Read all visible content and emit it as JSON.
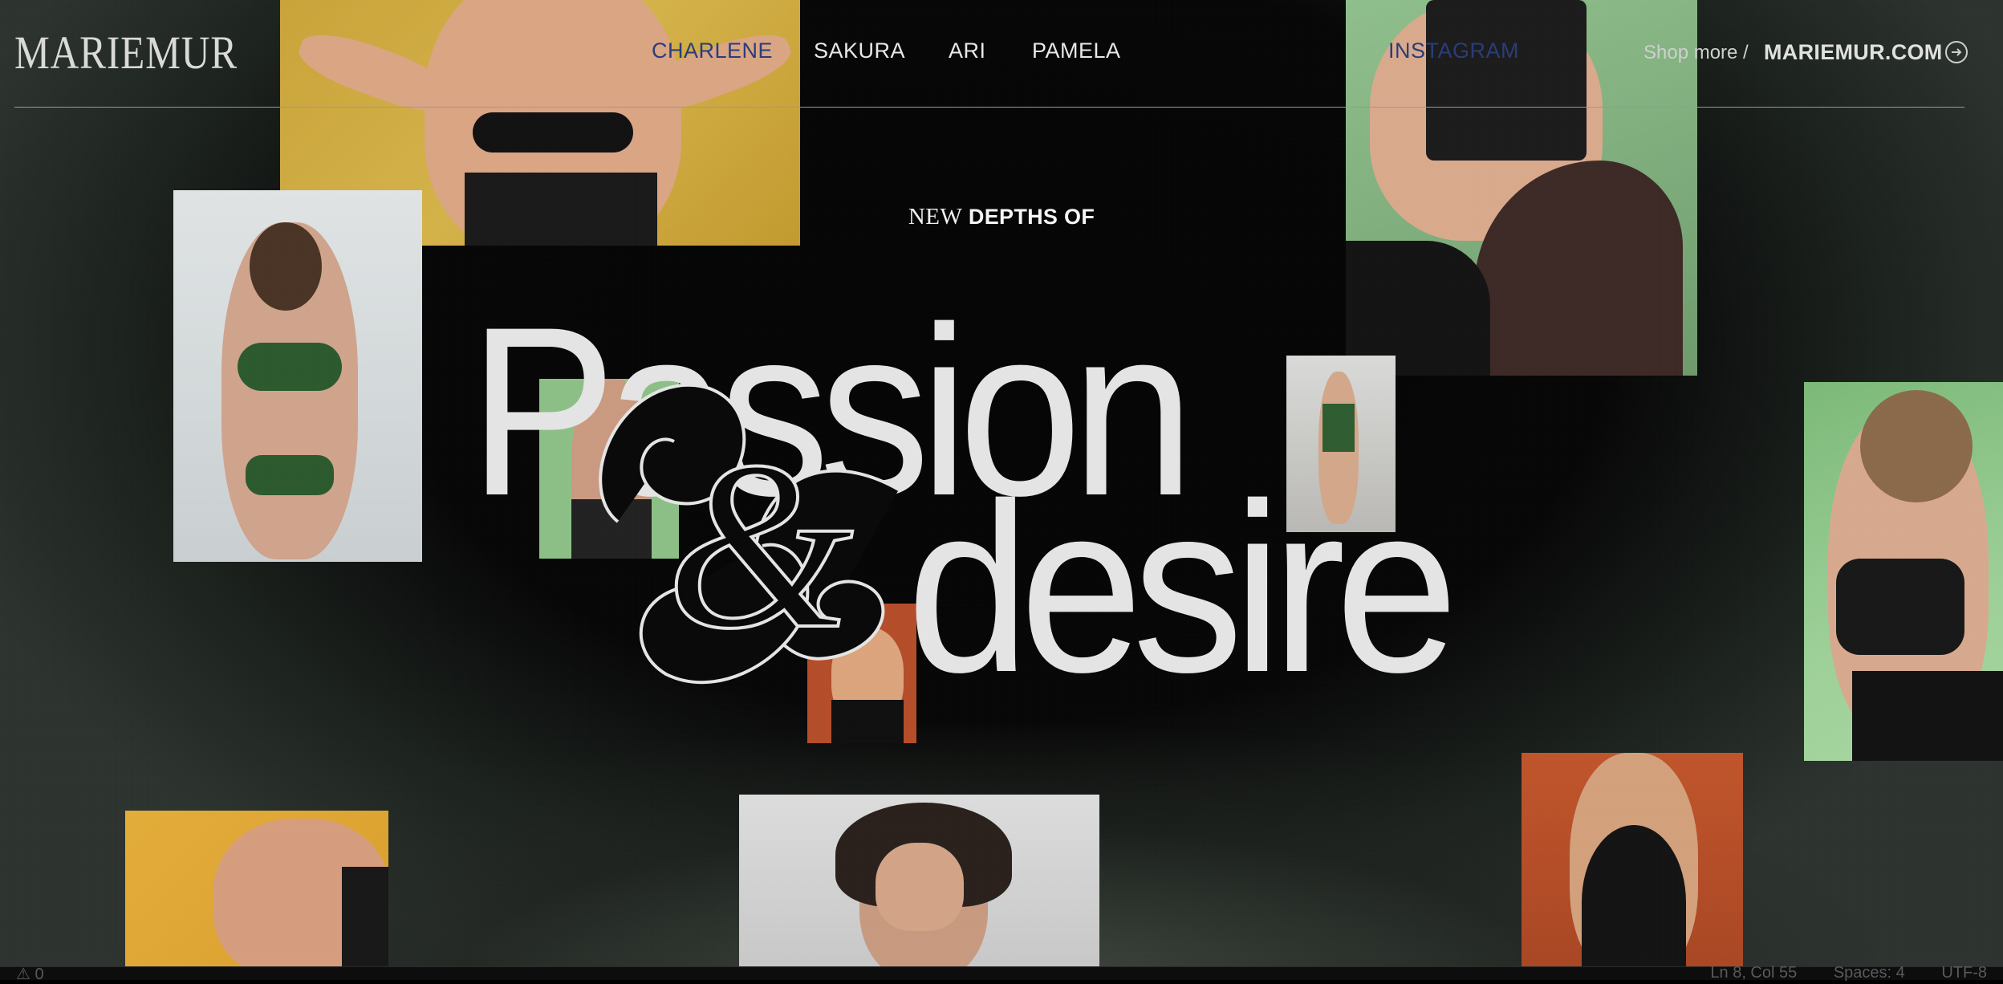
{
  "header": {
    "logo": "MARIEMUR",
    "nav": [
      {
        "label": "CHARLENE",
        "active": true
      },
      {
        "label": "SAKURA",
        "active": false
      },
      {
        "label": "ARI",
        "active": false
      },
      {
        "label": "PAMELA",
        "active": false
      }
    ],
    "instagram": "INSTAGRAM",
    "shop_more": "Shop more",
    "separator": "/",
    "domain": "MARIEMUR.COM",
    "arrow_icon": "arrow-right-circle-icon"
  },
  "hero": {
    "eyebrow_serif": "NEW",
    "eyebrow_bold": "DEPTHS OF",
    "line1": "Passion",
    "line2": "desire",
    "ampersand": "&"
  },
  "photos": [
    {
      "name": "photo-yellow-chain",
      "color": "#c9a33a"
    },
    {
      "name": "photo-green-harness-left",
      "color": "#dfe3e4"
    },
    {
      "name": "photo-green-bg-top-right",
      "color": "#8fbf8c"
    },
    {
      "name": "photo-green-small",
      "color": "#8cbf86"
    },
    {
      "name": "photo-standing-small",
      "color": "#d9dad8"
    },
    {
      "name": "photo-green-right",
      "color": "#7cb978"
    },
    {
      "name": "photo-orange-small",
      "color": "#b44d2a"
    },
    {
      "name": "photo-yellow-bottom-left",
      "color": "#e3ad3a"
    },
    {
      "name": "photo-grey-bottom",
      "color": "#dcdcdc"
    },
    {
      "name": "photo-orange-bottom-right",
      "color": "#c0552b"
    }
  ],
  "statusbar": {
    "left": "⚠ 0",
    "position": "Ln 8, Col 55",
    "spaces": "Spaces: 4",
    "encoding": "UTF-8"
  }
}
